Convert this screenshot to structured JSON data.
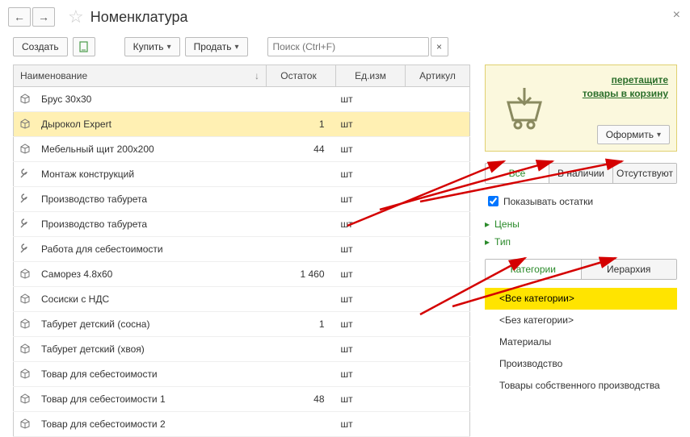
{
  "header": {
    "title": "Номенклатура"
  },
  "toolbar": {
    "create": "Создать",
    "buy": "Купить",
    "sell": "Продать",
    "search_placeholder": "Поиск (Ctrl+F)"
  },
  "grid": {
    "columns": {
      "name": "Наименование",
      "stock": "Остаток",
      "unit": "Ед.изм",
      "sku": "Артикул"
    },
    "rows": [
      {
        "icon": "box",
        "name": "Брус 30x30",
        "stock": "",
        "unit": "шт",
        "sku": "",
        "selected": false
      },
      {
        "icon": "box",
        "name": "Дырокол Expert",
        "stock": "1",
        "unit": "шт",
        "sku": "",
        "selected": true
      },
      {
        "icon": "box",
        "name": "Мебельный щит 200x200",
        "stock": "44",
        "unit": "шт",
        "sku": "",
        "selected": false
      },
      {
        "icon": "tools",
        "name": "Монтаж конструкций",
        "stock": "",
        "unit": "шт",
        "sku": "",
        "selected": false
      },
      {
        "icon": "tools",
        "name": "Производство табурета",
        "stock": "",
        "unit": "шт",
        "sku": "",
        "selected": false
      },
      {
        "icon": "tools",
        "name": "Производство табурета",
        "stock": "",
        "unit": "шт",
        "sku": "",
        "selected": false
      },
      {
        "icon": "tools",
        "name": "Работа для себестоимости",
        "stock": "",
        "unit": "шт",
        "sku": "",
        "selected": false
      },
      {
        "icon": "box",
        "name": "Саморез 4.8x60",
        "stock": "1 460",
        "unit": "шт",
        "sku": "",
        "selected": false
      },
      {
        "icon": "box",
        "name": "Сосиски с НДС",
        "stock": "",
        "unit": "шт",
        "sku": "",
        "selected": false
      },
      {
        "icon": "box",
        "name": "Табурет детский (сосна)",
        "stock": "1",
        "unit": "шт",
        "sku": "",
        "selected": false
      },
      {
        "icon": "box",
        "name": "Табурет детский (хвоя)",
        "stock": "",
        "unit": "шт",
        "sku": "",
        "selected": false
      },
      {
        "icon": "box",
        "name": "Товар для себестоимости",
        "stock": "",
        "unit": "шт",
        "sku": "",
        "selected": false
      },
      {
        "icon": "box",
        "name": "Товар для себестоимости 1",
        "stock": "48",
        "unit": "шт",
        "sku": "",
        "selected": false
      },
      {
        "icon": "box",
        "name": "Товар для себестоимости 2",
        "stock": "",
        "unit": "шт",
        "sku": "",
        "selected": false
      }
    ]
  },
  "sidebar": {
    "cart_link_line1": "перетащите",
    "cart_link_line2": "товары в корзину",
    "oformit": "Оформить",
    "filter_tabs": {
      "all": "Все",
      "instock": "В наличии",
      "absent": "Отсутствуют"
    },
    "show_stock": "Показывать остатки",
    "accordion": {
      "prices": "Цены",
      "type": "Тип"
    },
    "view_tabs": {
      "cats": "Категории",
      "tree": "Иерархия"
    },
    "categories": [
      {
        "label": "<Все категории>",
        "selected": true
      },
      {
        "label": "<Без категории>",
        "selected": false
      },
      {
        "label": "Материалы",
        "selected": false
      },
      {
        "label": "Производство",
        "selected": false
      },
      {
        "label": "Товары собственного производства",
        "selected": false
      }
    ]
  }
}
